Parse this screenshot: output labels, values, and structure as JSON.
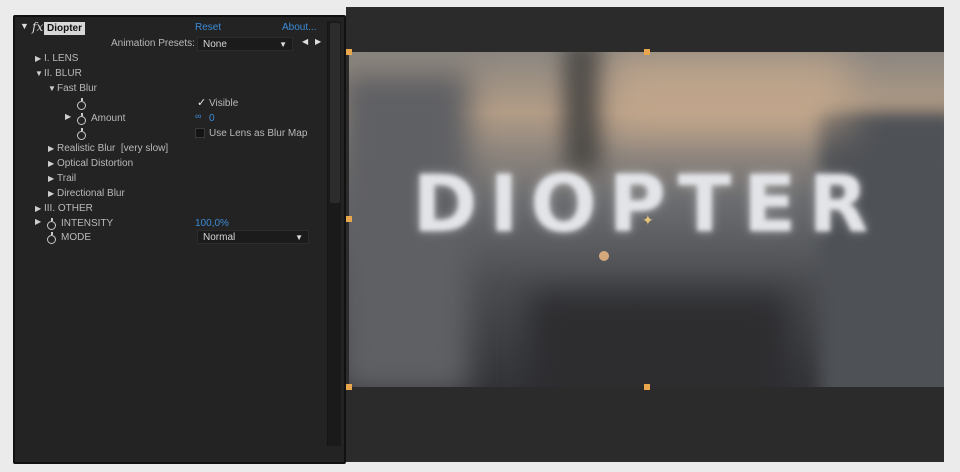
{
  "panel": {
    "effect_label": "fx",
    "effect_name": "Diopter",
    "reset_label": "Reset",
    "about_label": "About...",
    "presets_label": "Animation Presets:",
    "presets_value": "None",
    "tree": {
      "lens": "I. LENS",
      "blur": "II. BLUR",
      "fast_blur": "Fast Blur",
      "visible_label": "Visible",
      "amount_label": "Amount",
      "amount_value": "0",
      "use_lens_label": "Use Lens as Blur Map",
      "realistic_blur": "Realistic Blur  [very slow]",
      "optical_distortion": "Optical Distortion",
      "trail": "Trail",
      "directional_blur": "Directional Blur",
      "other": "III. OTHER",
      "intensity_label": "INTENSITY",
      "intensity_value": "100,0%",
      "mode_label": "MODE",
      "mode_value": "Normal"
    }
  },
  "viewer": {
    "title_text": "DIOPTER"
  },
  "colors": {
    "accent_blue": "#3b8cd8",
    "panel_bg": "#232323",
    "handle_orange": "#e8a64d"
  }
}
